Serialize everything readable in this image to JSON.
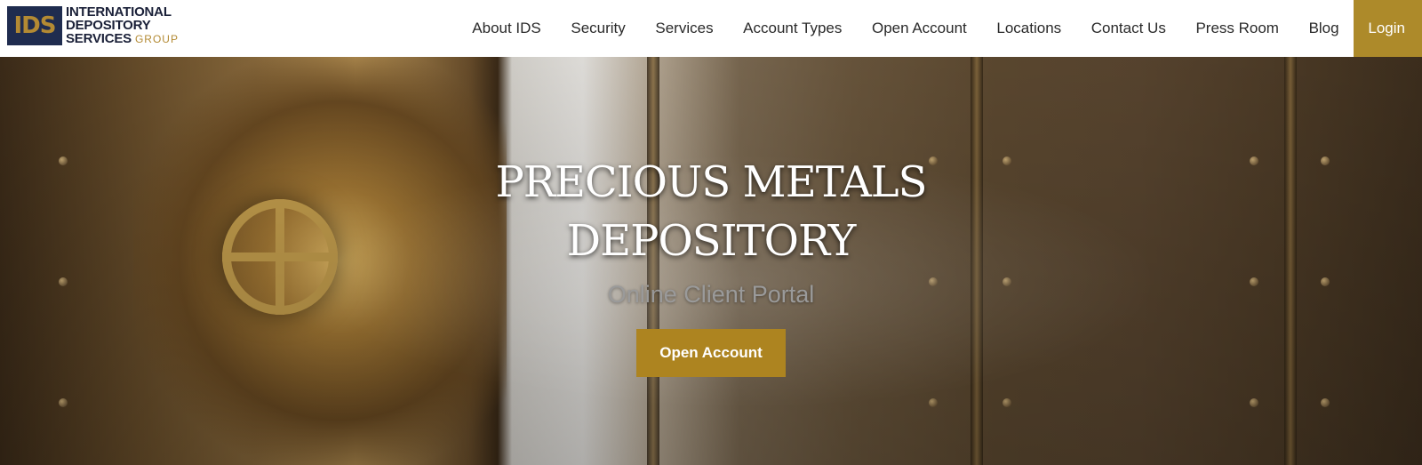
{
  "header": {
    "logo": {
      "mark": "IDS",
      "line1": "INTERNATIONAL",
      "line2": "DEPOSITORY",
      "line3": "SERVICES",
      "line3_suffix": "GROUP"
    },
    "nav": [
      {
        "label": "About IDS"
      },
      {
        "label": "Security"
      },
      {
        "label": "Services"
      },
      {
        "label": "Account Types"
      },
      {
        "label": "Open Account"
      },
      {
        "label": "Locations"
      },
      {
        "label": "Contact Us"
      },
      {
        "label": "Press Room"
      },
      {
        "label": "Blog"
      }
    ],
    "login_label": "Login"
  },
  "hero": {
    "title_line1": "PRECIOUS METALS",
    "title_line2": "DEPOSITORY",
    "subtitle": "Online Client Portal",
    "cta_label": "Open Account"
  },
  "colors": {
    "accent_gold": "#ad8a2a",
    "logo_navy": "#1f2c4f"
  }
}
